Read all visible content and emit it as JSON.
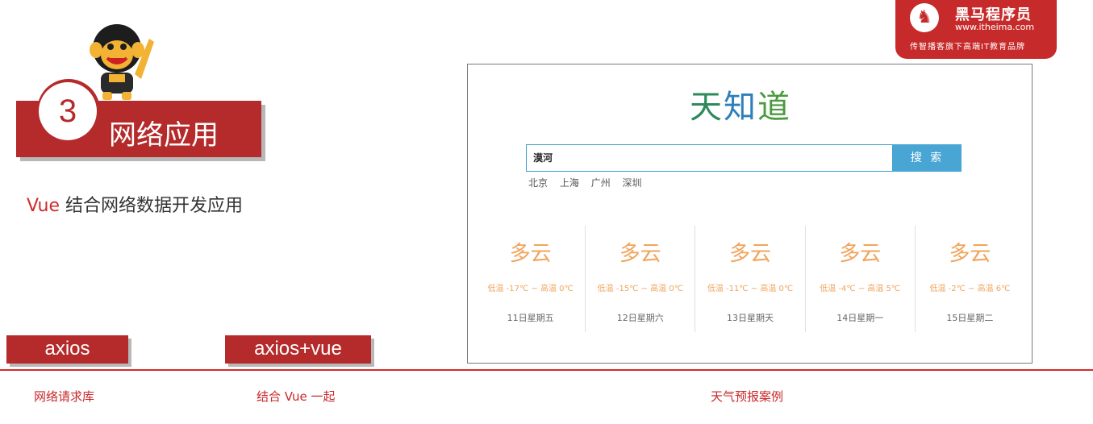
{
  "brand": {
    "name": "黑马程序员",
    "url": "www.itheima.com",
    "slogan": "传智播客旗下高端IT教育品牌"
  },
  "section": {
    "number": "3",
    "title": "网络应用"
  },
  "subtitle": {
    "accent": "Vue",
    "text": " 结合网络数据开发应用"
  },
  "features": [
    {
      "label": "axios",
      "caption": "网络请求库"
    },
    {
      "label": "axios+vue",
      "caption": "结合 Vue 一起"
    }
  ],
  "demo": {
    "caption": "天气预报案例",
    "logo": [
      "天",
      "知",
      "道"
    ],
    "search_value": "漠河",
    "search_button": "搜 索",
    "hot_cities": [
      "北京",
      "上海",
      "广州",
      "深圳"
    ],
    "forecast": [
      {
        "type": "多云",
        "temp": "低温 -17℃ ~ 高温 0℃",
        "date": "11日星期五"
      },
      {
        "type": "多云",
        "temp": "低温 -15℃ ~ 高温 0℃",
        "date": "12日星期六"
      },
      {
        "type": "多云",
        "temp": "低温 -11℃ ~ 高温 0℃",
        "date": "13日星期天"
      },
      {
        "type": "多云",
        "temp": "低温 -4℃ ~ 高温 5℃",
        "date": "14日星期一"
      },
      {
        "type": "多云",
        "temp": "低温 -2℃ ~ 高温 6℃",
        "date": "15日星期二"
      }
    ]
  },
  "colors": {
    "brand_red": "#c72a2a",
    "forecast_orange": "#f0a45c",
    "search_blue": "#49a6d4"
  }
}
